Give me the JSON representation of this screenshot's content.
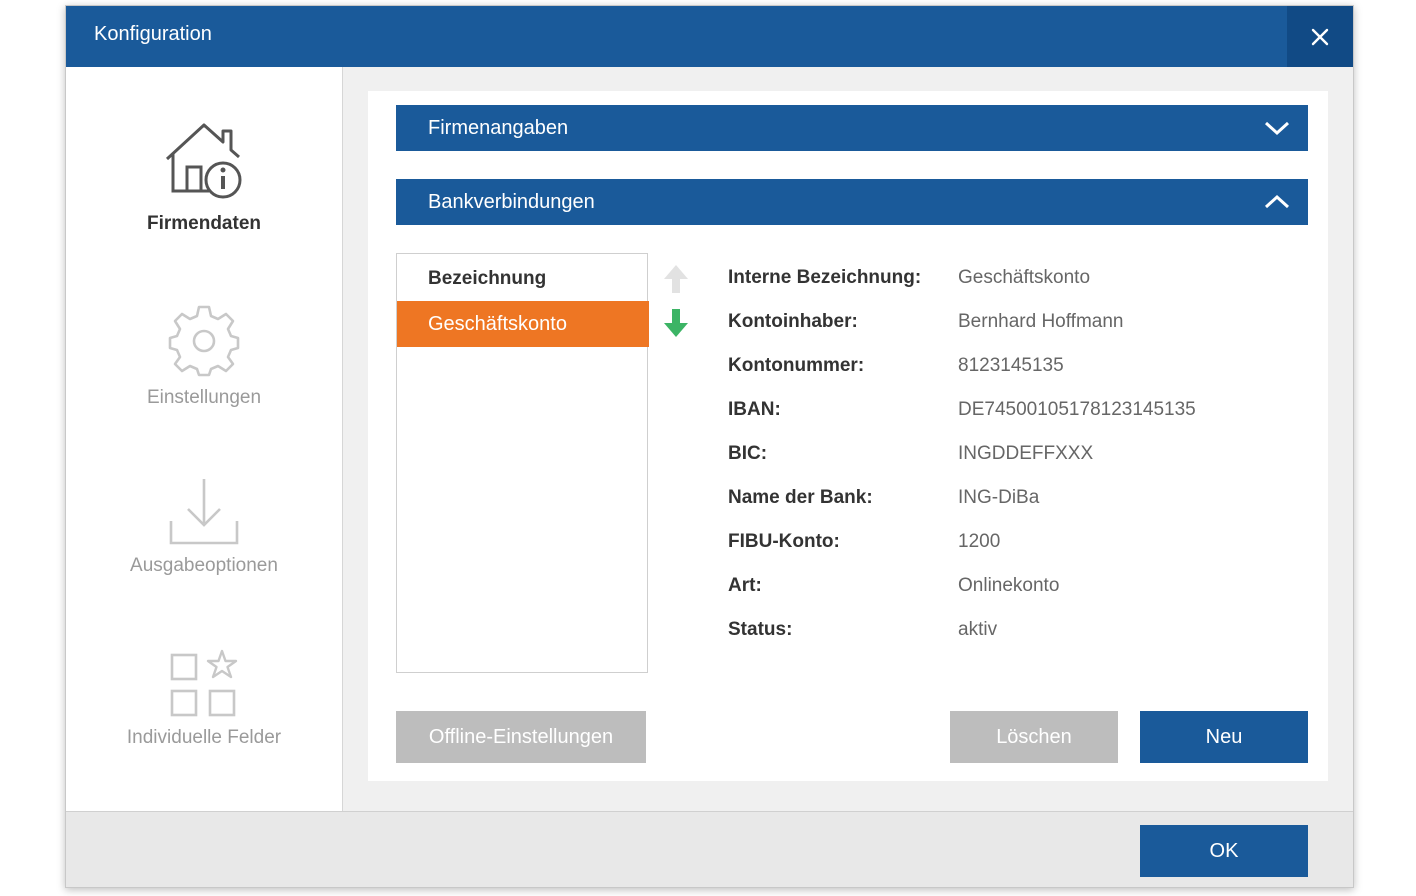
{
  "window": {
    "title": "Konfiguration"
  },
  "sidebar": {
    "items": [
      {
        "label": "Firmendaten",
        "icon": "house-info-icon",
        "active": true
      },
      {
        "label": "Einstellungen",
        "icon": "gear-icon",
        "active": false
      },
      {
        "label": "Ausgabeoptionen",
        "icon": "download-icon",
        "active": false
      },
      {
        "label": "Individuelle Felder",
        "icon": "grid-star-icon",
        "active": false
      }
    ]
  },
  "sections": {
    "firmenangaben": {
      "label": "Firmenangaben",
      "state": "collapsed"
    },
    "bankverbindungen": {
      "label": "Bankverbindungen",
      "state": "expanded"
    }
  },
  "list": {
    "header": "Bezeichnung",
    "items": [
      {
        "label": "Geschäftskonto",
        "selected": true
      }
    ]
  },
  "details": [
    {
      "label": "Interne Bezeichnung:",
      "value": "Geschäftskonto"
    },
    {
      "label": "Kontoinhaber:",
      "value": "Bernhard Hoffmann"
    },
    {
      "label": "Kontonummer:",
      "value": "8123145135"
    },
    {
      "label": "IBAN:",
      "value": "DE74500105178123145135"
    },
    {
      "label": "BIC:",
      "value": "INGDDEFFXXX"
    },
    {
      "label": "Name der Bank:",
      "value": "ING-DiBa"
    },
    {
      "label": "FIBU-Konto:",
      "value": "1200"
    },
    {
      "label": "Art:",
      "value": "Onlinekonto"
    },
    {
      "label": "Status:",
      "value": "aktiv"
    }
  ],
  "buttons": {
    "offline": "Offline-Einstellungen",
    "delete": "Löschen",
    "new": "Neu",
    "ok": "OK"
  },
  "colors": {
    "primary": "#1a5a9a",
    "accent_orange": "#ee7623",
    "arrow_green": "#3cb465",
    "disabled_gray": "#bdbdbd"
  }
}
